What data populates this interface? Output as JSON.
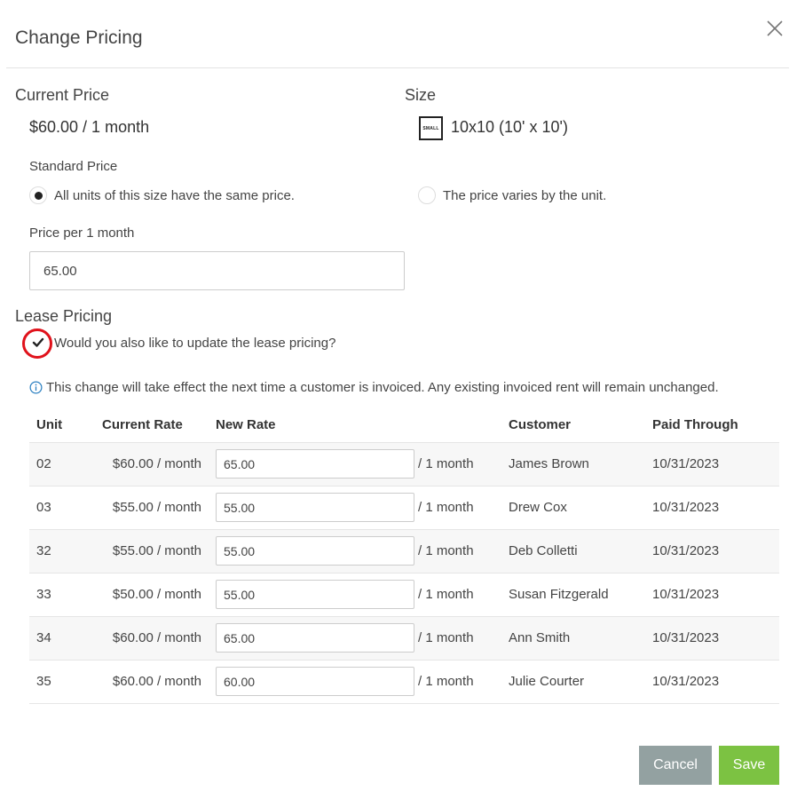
{
  "modal": {
    "title": "Change Pricing",
    "close_icon": "close-icon"
  },
  "current_price": {
    "heading": "Current Price",
    "value": "$60.00 / 1 month"
  },
  "size": {
    "heading": "Size",
    "badge": "SMALL",
    "value": "10x10  (10' x 10')"
  },
  "standard_price": {
    "label": "Standard Price",
    "options": [
      {
        "label": "All units of this size have the same price.",
        "selected": true
      },
      {
        "label": "The price varies by the unit.",
        "selected": false
      }
    ],
    "price_label": "Price per 1 month",
    "price_value": "65.00"
  },
  "lease_pricing": {
    "heading": "Lease Pricing",
    "checkbox_label": "Would you also like to update the lease pricing?",
    "checked": true,
    "info_icon": "info-circle-icon",
    "info_text": "This change will take effect the next time a customer is invoiced. Any existing invoiced rent will remain unchanged."
  },
  "table": {
    "headers": {
      "unit": "Unit",
      "current_rate": "Current Rate",
      "new_rate": "New Rate",
      "customer": "Customer",
      "paid_through": "Paid Through"
    },
    "rows": [
      {
        "unit": "02",
        "current_rate": "$60.00 / month",
        "new_rate": "65.00",
        "per": "/ 1 month",
        "customer": "James Brown",
        "paid_through": "10/31/2023"
      },
      {
        "unit": "03",
        "current_rate": "$55.00 / month",
        "new_rate": "55.00",
        "per": "/ 1 month",
        "customer": "Drew Cox",
        "paid_through": "10/31/2023"
      },
      {
        "unit": "32",
        "current_rate": "$55.00 / month",
        "new_rate": "55.00",
        "per": "/ 1 month",
        "customer": "Deb Colletti",
        "paid_through": "10/31/2023"
      },
      {
        "unit": "33",
        "current_rate": "$50.00 / month",
        "new_rate": "55.00",
        "per": "/ 1 month",
        "customer": "Susan Fitzgerald",
        "paid_through": "10/31/2023"
      },
      {
        "unit": "34",
        "current_rate": "$60.00 / month",
        "new_rate": "65.00",
        "per": "/ 1 month",
        "customer": "Ann Smith",
        "paid_through": "10/31/2023"
      },
      {
        "unit": "35",
        "current_rate": "$60.00 / month",
        "new_rate": "60.00",
        "per": "/ 1 month",
        "customer": "Julie Courter",
        "paid_through": "10/31/2023"
      }
    ]
  },
  "footer": {
    "cancel_label": "Cancel",
    "save_label": "Save"
  },
  "colors": {
    "cancel": "#93a1a1",
    "save": "#7cc242",
    "highlight": "#e0121b",
    "info": "#2a7fc1"
  }
}
